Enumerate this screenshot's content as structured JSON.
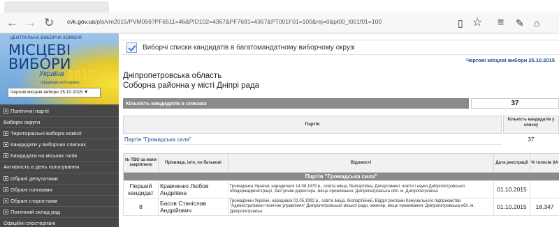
{
  "browser": {
    "url_host": "cvk.gov.ua",
    "url_rest": "/pls/vm2015/PVM056?PF6511=46&PID102=4367&PF7691=4367&PT001F01=100&rej=0&pt00_t001f01=100",
    "icons": [
      "back-icon",
      "forward-icon",
      "refresh-icon",
      "reading-view-icon",
      "favorite-star-icon",
      "hub-icon",
      "notes-icon",
      "share-icon"
    ]
  },
  "sidebar": {
    "banner": {
      "org": "ЦЕНТРАЛЬНА ВИБОРЧА КОМІСІЯ",
      "title_line1": "МІСЦЕВІ",
      "title_line2": "ВИБОРИ",
      "country": "Україна",
      "year": "2015",
      "subtitle": "офіційний веб-сервер"
    },
    "election_select": "Чергові місцеві вибори 25.10.2015 ▼",
    "menu": [
      {
        "label": "Політичні партії",
        "expandable": true
      },
      {
        "label": "Виборчі округи",
        "expandable": false
      },
      {
        "label": "Територіальні виборчі комісії",
        "expandable": true
      },
      {
        "label": "Кандидати у виборчих списках",
        "expandable": true
      },
      {
        "label": "Кандидати на міських голів",
        "expandable": true
      },
      {
        "label": "Активність в день голосування",
        "expandable": false
      },
      {
        "label": "Обрані депутатами",
        "expandable": true
      },
      {
        "label": "Обрані головами",
        "expandable": true
      },
      {
        "label": "Обрані старостами",
        "expandable": true
      },
      {
        "label": "Поточний склад рад",
        "expandable": true
      },
      {
        "label": "Офіційні спостерігачі",
        "expandable": false
      }
    ]
  },
  "main": {
    "header_title": "Виборчі списки кандидатів в багатомандатному виборчому окрузі",
    "election_date": "Чергові місцеві вибори 25.10.2015",
    "region": "Дніпропетровська область",
    "council": "Соборна районна у місті Дніпрі рада",
    "count_label": "Кількість кандидатів в списках",
    "count_value": "37",
    "party_table": {
      "col_party": "Партія",
      "col_count": "Кількість кандидатів у списку",
      "rows": [
        {
          "party": "Партія \"Громадська сила\"",
          "count": "37"
        }
      ]
    },
    "candidates_table": {
      "headers": {
        "number": "№ ТВО за яким закріплено",
        "name": "Прізвище, ім'я, по батькові",
        "info": "Відомості",
        "date": "Дата реєстрації",
        "percent": "% голосів ЗА"
      },
      "group": "Партія \"Громадська сила\"",
      "rows": [
        {
          "number": "Перший кандидат",
          "name": "Кравченко Любов Андріївна",
          "info": "Громадянка України, народилася 14.08.1979 р., освіта вища, безпартійна, Департамент освіти і науки Дніпропетровської облдержадміністрації, Заступник директора, місце проживання: Дніпропетровська обл. м. Дніпропетровськ",
          "date": "01.10.2015",
          "percent": ""
        },
        {
          "number": "8",
          "name": "Басов Станіслав Андрійович",
          "info": "Громадянин України, народився 01.05.1992 р., освіта вища, безпартійний, Відділ реклами Комунального підприємства \"Адміністративно-технічне управління\" Дніпропетровської міської ради, інженер, місце проживання: Дніпропетровська обл. м. Дніпропетровськ",
          "date": "01.10.2015",
          "percent": "18,347"
        }
      ]
    }
  }
}
